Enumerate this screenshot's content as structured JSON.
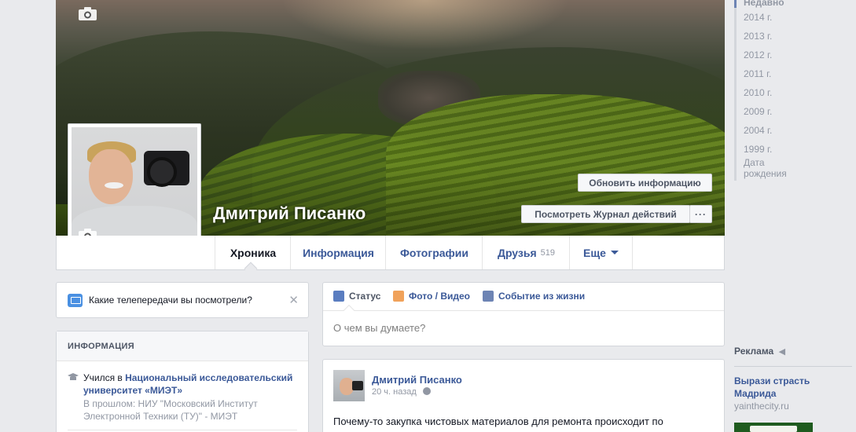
{
  "profile": {
    "name": "Дмитрий Писанко",
    "update_info_label": "Обновить информацию",
    "activity_log_label": "Посмотреть Журнал действий",
    "more_label": "···"
  },
  "nav": {
    "tabs": [
      {
        "label": "Хроника"
      },
      {
        "label": "Информация"
      },
      {
        "label": "Фотографии"
      },
      {
        "label": "Друзья",
        "count": "519"
      },
      {
        "label": "Еще"
      }
    ]
  },
  "timeline_years": [
    "Недавно",
    "2014 г.",
    "2013 г.",
    "2012 г.",
    "2011 г.",
    "2010 г.",
    "2009 г.",
    "2004 г.",
    "1999 г.",
    "Дата рождения"
  ],
  "tv_prompt": {
    "text": "Какие телепередачи вы посмотрели?",
    "close_label": "✕"
  },
  "info": {
    "heading": "ИНФОРМАЦИЯ",
    "edu_prefix": "Учился в ",
    "edu_link": "Национальный исследовательский университет «МИЭТ»",
    "edu_sub": "В прошлом: НИУ \"Московский Институт Электронной Техники (ТУ)\" - МИЭТ"
  },
  "composer": {
    "tab_status": "Статус",
    "tab_photo": "Фото / Видео",
    "tab_event": "Событие из жизни",
    "placeholder": "О чем вы думаете?"
  },
  "post": {
    "author": "Дмитрий Писанко",
    "time": "20 ч. назад",
    "text": "Почему-то закупка чистовых материалов для ремонта происходит по"
  },
  "ads": {
    "heading": "Реклама",
    "title": "Вырази страсть Мадрида",
    "url": "yainthecity.ru"
  },
  "colors": {
    "link": "#3b5998",
    "background": "#e9eaed",
    "muted": "#9197a3"
  }
}
